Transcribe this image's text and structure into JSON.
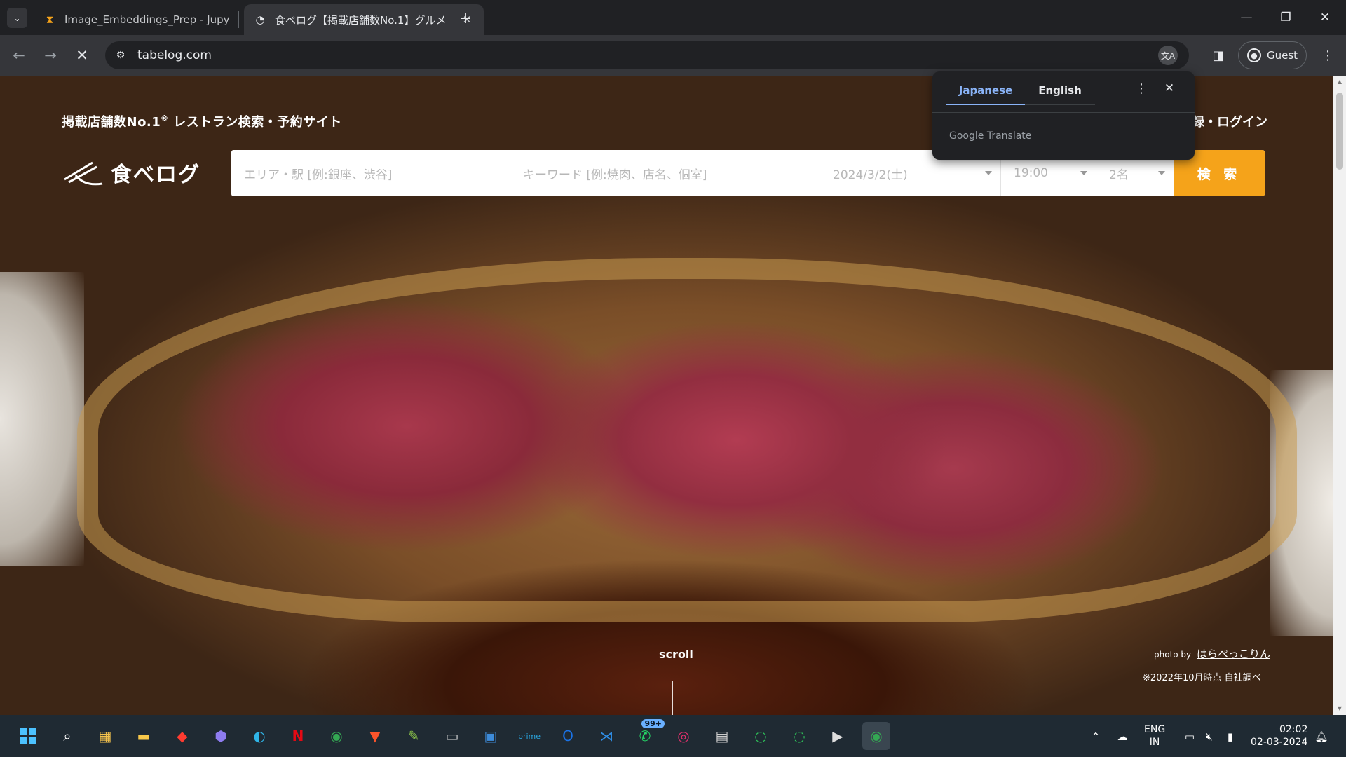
{
  "browser": {
    "tabs": [
      {
        "title": "Image_Embeddings_Prep - Jupy",
        "favicon": "hourglass-icon",
        "active": false
      },
      {
        "title": "食べログ【掲載店舗数No.1】グルメ",
        "favicon": "loading-spinner-icon",
        "active": true
      }
    ],
    "new_tab_label": "+",
    "url": "tabelog.com",
    "profile_label": "Guest",
    "window_controls": {
      "minimize": "—",
      "restore": "❐",
      "close": "✕"
    }
  },
  "page": {
    "tagline": "掲載店舗数No.1",
    "tagline_mark": "※",
    "tagline_rest": " レストラン検索・予約サイト",
    "login_link": "録・ログイン",
    "logo_text": "食べログ",
    "search": {
      "area_placeholder": "エリア・駅 [例:銀座、渋谷]",
      "keyword_placeholder": "キーワード [例:焼肉、店名、個室]",
      "date": "2024/3/2(土)",
      "time": "19:00",
      "people": "2名",
      "button": "検 索"
    },
    "scroll_label": "scroll",
    "photo_credit_prefix": "photo by",
    "photo_credit_name": "はらぺっこりん",
    "survey_note": "※2022年10月時点 自社調べ"
  },
  "translate_popup": {
    "tab_japanese": "Japanese",
    "tab_english": "English",
    "footer": "Google Translate"
  },
  "taskbar": {
    "apps": [
      "start",
      "search",
      "store",
      "file-explorer",
      "app-red",
      "app-purple",
      "edge",
      "netflix",
      "chrome",
      "brave",
      "notepad-plus",
      "terminal-black",
      "windows-security",
      "prime-video",
      "outlook",
      "vscode",
      "whatsapp",
      "instagram",
      "app-window",
      "app-ring-green",
      "app-ring-green-2",
      "terminal",
      "chrome-active"
    ],
    "whatsapp_badge": "99+",
    "language_top": "ENG",
    "language_bottom": "IN",
    "time": "02:02",
    "date": "02-03-2024"
  }
}
